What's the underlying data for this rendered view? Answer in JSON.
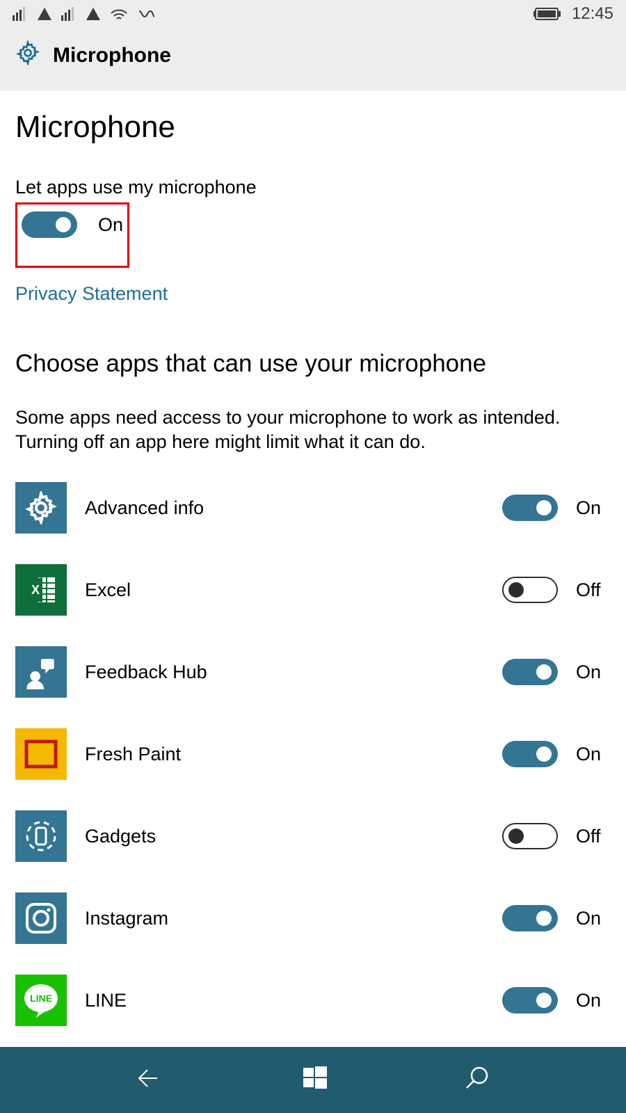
{
  "statusbar": {
    "time": "12:45"
  },
  "header": {
    "title": "Microphone"
  },
  "page": {
    "title": "Microphone",
    "master_label": "Let apps use my microphone",
    "master_state": "On",
    "link": "Privacy Statement",
    "section_title": "Choose apps that can use your microphone",
    "section_sub": "Some apps need access to your microphone to work as intended. Turning off an app here might limit what it can do."
  },
  "apps": [
    {
      "name": "Advanced info",
      "state": "On",
      "on": true,
      "icon": "advanced"
    },
    {
      "name": "Excel",
      "state": "Off",
      "on": false,
      "icon": "excel"
    },
    {
      "name": "Feedback Hub",
      "state": "On",
      "on": true,
      "icon": "feedback"
    },
    {
      "name": "Fresh Paint",
      "state": "On",
      "on": true,
      "icon": "fresh"
    },
    {
      "name": "Gadgets",
      "state": "Off",
      "on": false,
      "icon": "gadgets"
    },
    {
      "name": "Instagram",
      "state": "On",
      "on": true,
      "icon": "instagram"
    },
    {
      "name": "LINE",
      "state": "On",
      "on": true,
      "icon": "line"
    }
  ]
}
